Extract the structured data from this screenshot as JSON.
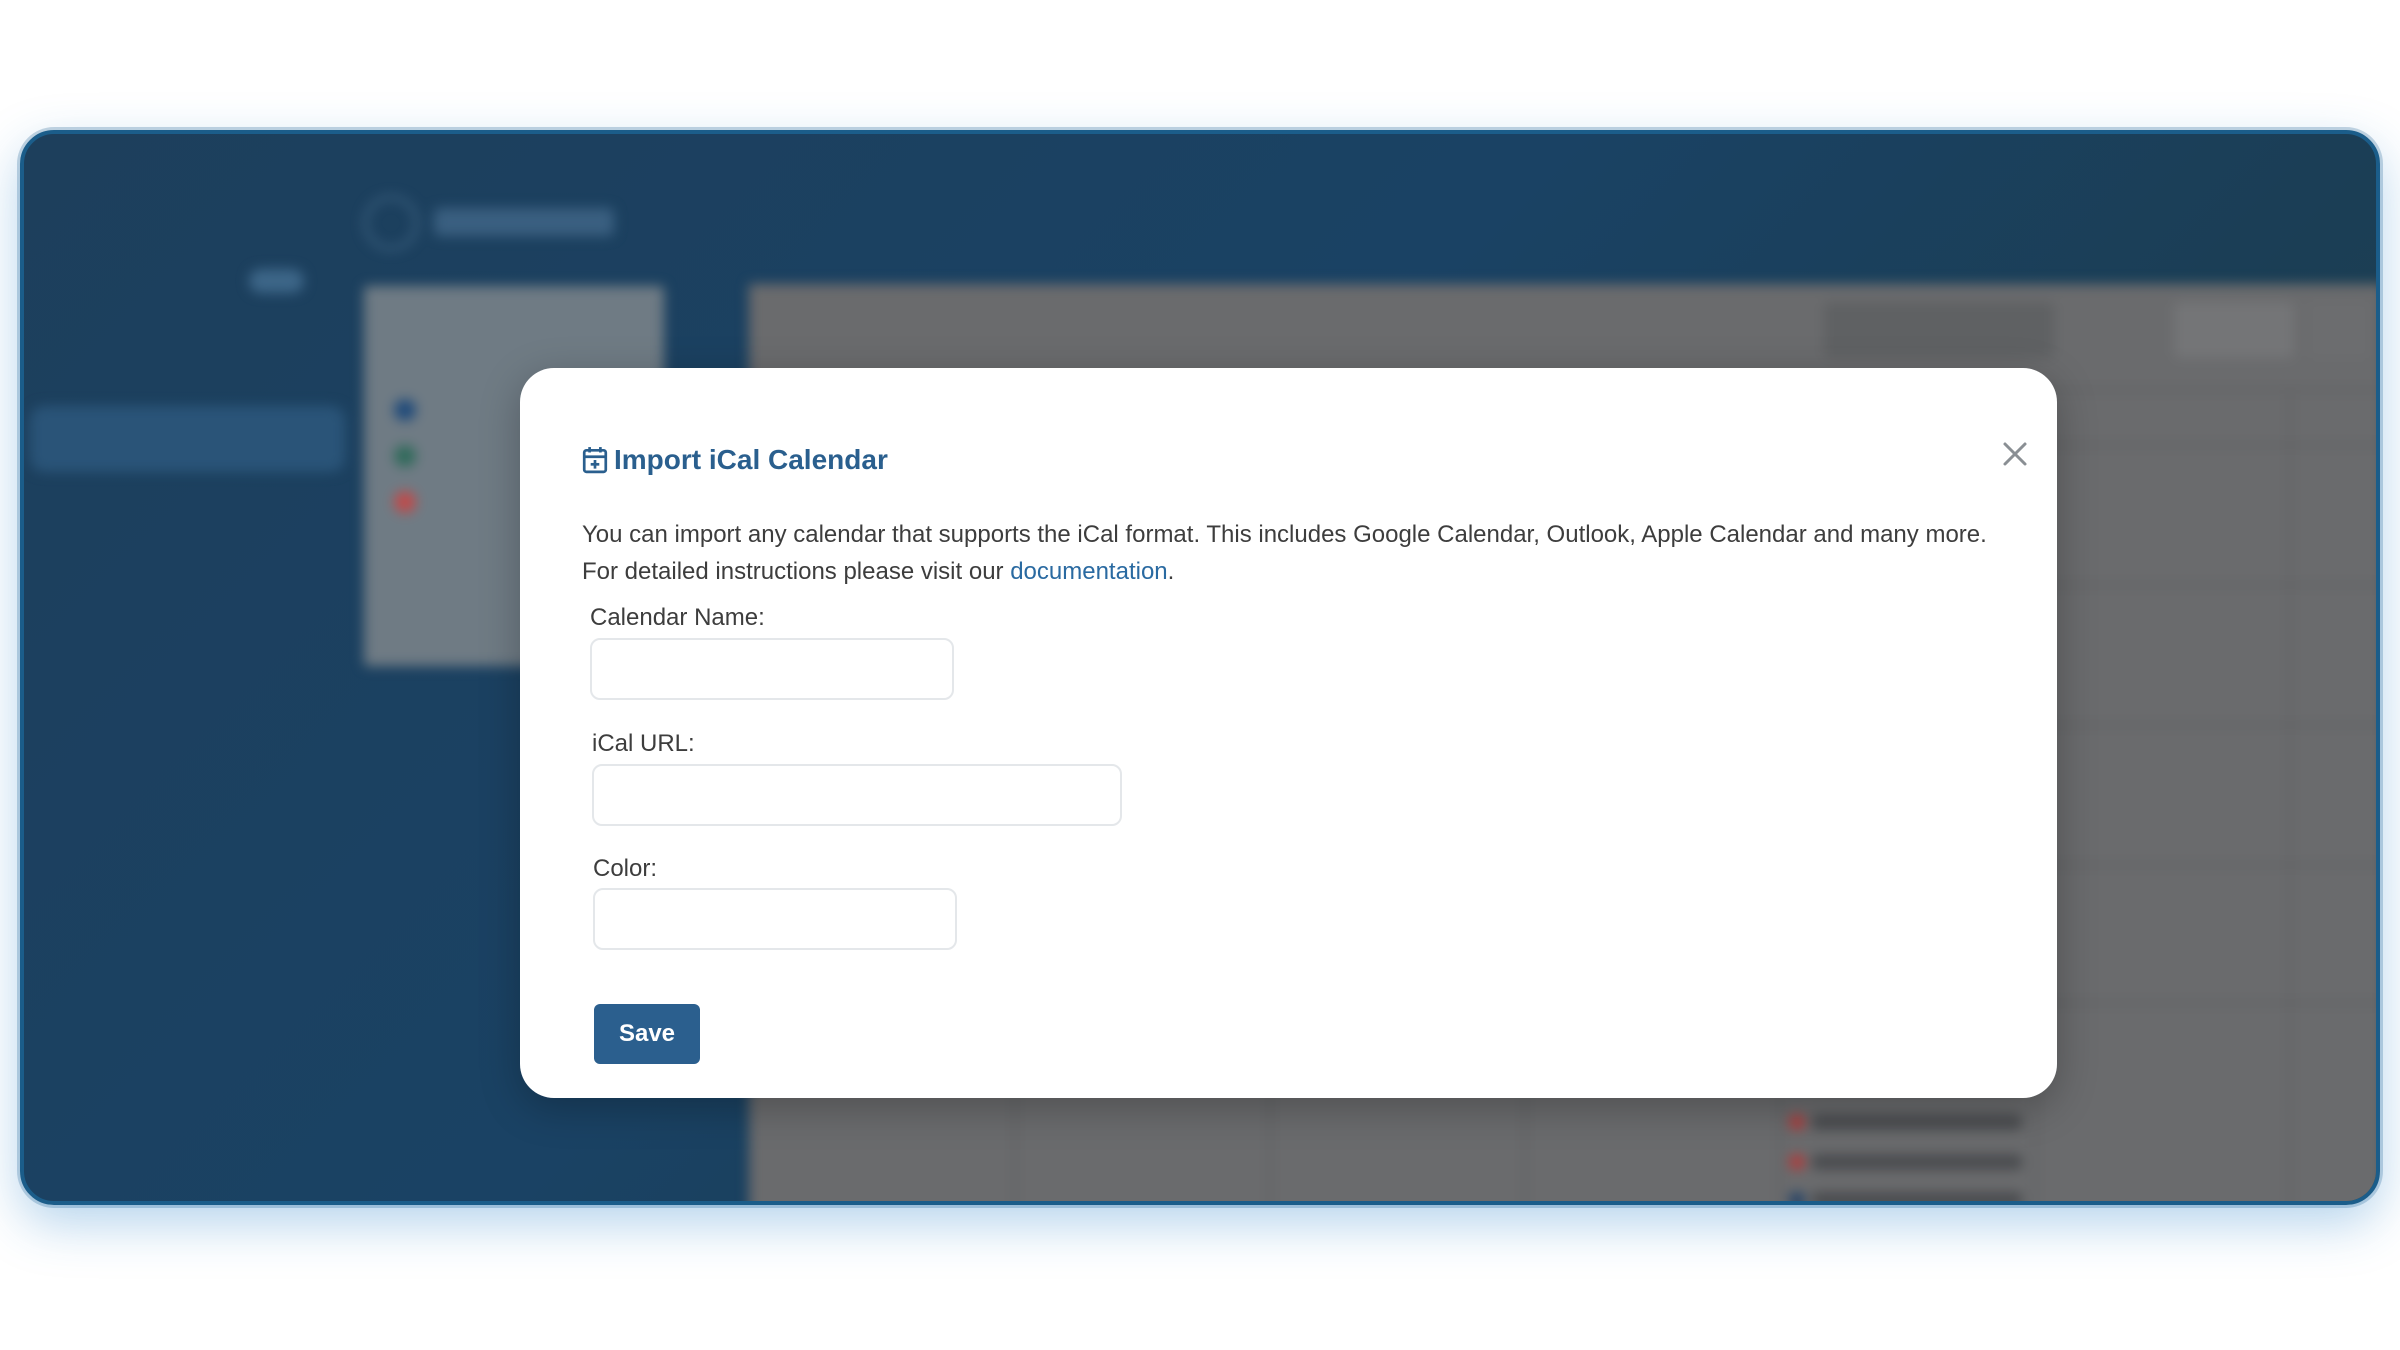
{
  "modal": {
    "title": "Import iCal Calendar",
    "title_icon": "calendar-plus-icon",
    "close_icon": "close-icon",
    "description": {
      "intro": "You can import any calendar that supports the iCal format. This includes Google Calendar, Outlook, Apple Calendar and many more.",
      "instructions_prefix": "For detailed instructions please visit our ",
      "link_text": "documentation",
      "instructions_suffix": "."
    },
    "fields": {
      "calendar_name": {
        "label": "Calendar Name:",
        "value": "",
        "placeholder": ""
      },
      "ical_url": {
        "label": "iCal URL:",
        "value": "",
        "placeholder": ""
      },
      "color": {
        "label": "Color:",
        "value": "",
        "placeholder": ""
      }
    },
    "save_label": "Save"
  },
  "colors": {
    "accent": "#2b5f8e",
    "link": "#2a6aa1",
    "frame_border": "#1b5d8a",
    "background_dark": "#1d3f5c"
  }
}
